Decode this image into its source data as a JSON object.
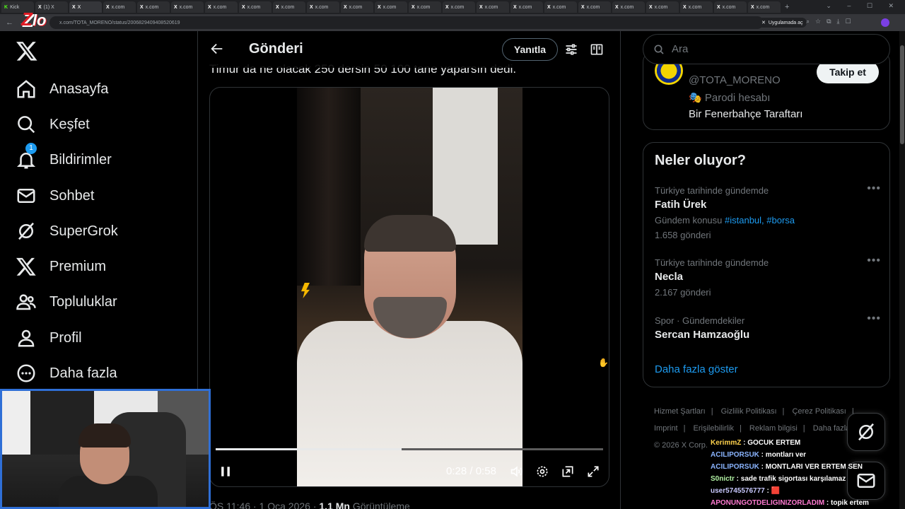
{
  "browser": {
    "tabs": [
      "Kick",
      "(1) X",
      "X",
      "x.com",
      "x.com",
      "x.com",
      "x.com",
      "x.com",
      "x.com",
      "x.com",
      "x.com",
      "x.com",
      "x.com",
      "x.com",
      "x.com",
      "x.com",
      "x.com",
      "x.com",
      "x.com",
      "x.com",
      "x.com",
      "x.com",
      "x.com"
    ],
    "url": "x.com/TOTA_MORENO/status/2006829409408520619",
    "app_chip": "Uygulamada aç"
  },
  "sidebar": {
    "items": [
      {
        "label": "Anasayfa",
        "icon": "home-icon"
      },
      {
        "label": "Keşfet",
        "icon": "search-icon"
      },
      {
        "label": "Bildirimler",
        "icon": "bell-icon",
        "badge": "1"
      },
      {
        "label": "Sohbet",
        "icon": "mail-icon"
      },
      {
        "label": "SuperGrok",
        "icon": "grok-icon"
      },
      {
        "label": "Premium",
        "icon": "x-icon"
      },
      {
        "label": "Topluluklar",
        "icon": "people-icon"
      },
      {
        "label": "Profil",
        "icon": "person-icon"
      },
      {
        "label": "Daha fazla",
        "icon": "more-icon"
      }
    ]
  },
  "post": {
    "header_title": "Gönderi",
    "reply_label": "Yanıtla",
    "text": "Timur da ne olacak 250 dersin 50 100 tane yaparsın dedi.",
    "video": {
      "current": "0:28",
      "duration": "0:58",
      "separator": "/",
      "progress": 0.48
    },
    "meta_time": "ÖS 11:46 · 1 Oca 2026 · ",
    "meta_views_count": "1,1 Mn",
    "meta_views_label": " Görüntüleme"
  },
  "right": {
    "search_placeholder": "Ara",
    "profile": {
      "handle": "@TOTA_MORENO",
      "parody": "Parodi hesabı",
      "bio": "Bir Fenerbahçe Taraftarı",
      "follow_label": "Takip et"
    },
    "trends_title": "Neler oluyor?",
    "trends": [
      {
        "context": "Türkiye tarihinde gündemde",
        "name": "Fatih Ürek",
        "topic_prefix": "Gündem konusu ",
        "tags": "#istanbul, #borsa",
        "count": "1.658 gönderi"
      },
      {
        "context": "Türkiye tarihinde gündemde",
        "name": "Necla",
        "count": "2.167 gönderi"
      },
      {
        "context": "Spor · Gündemdekiler",
        "name": "Sercan Hamzaoğlu"
      }
    ],
    "show_more": "Daha fazla göster",
    "footer": [
      "Hizmet Şartları",
      "Gizlilik Politikası",
      "Çerez Politikası",
      "Imprint",
      "Erişilebilirlik",
      "Reklam bilgisi",
      "Daha fazla",
      "© 2026 X Corp."
    ]
  },
  "chat": [
    {
      "user": "KerimmZ",
      "msg": "GOCUK ERTEM"
    },
    {
      "user": "ACILIPORSUK",
      "msg": "montları ver"
    },
    {
      "user": "ACILIPORSUK",
      "msg": "MONTLARI VER ERTEM SEN"
    },
    {
      "user": "S0nictr",
      "msg": "sade trafik sigortası karşılamaz"
    },
    {
      "user": "user5745576777",
      "msg": "🟥"
    },
    {
      "user": "APONUNGOTDELIGINIZORLADIM",
      "msg": "topik ertem"
    }
  ],
  "colors": {
    "accent": "#1d9bf0",
    "background": "#000000",
    "cam_border": "#2f6fd6"
  }
}
